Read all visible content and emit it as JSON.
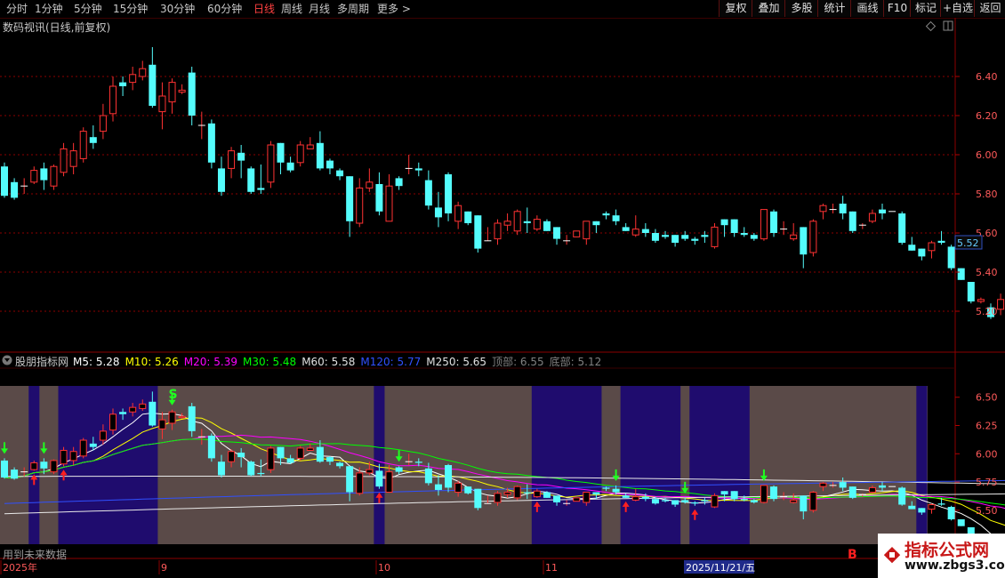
{
  "toolbar": {
    "timeframes": [
      "分时",
      "1分钟",
      "5分钟",
      "15分钟",
      "30分钟",
      "60分钟",
      "日线",
      "周线",
      "月线",
      "多周期",
      "更多 >"
    ],
    "active": "日线",
    "buttons": [
      "复权",
      "叠加",
      "多股",
      "统计",
      "画线",
      "F10",
      "标记",
      "+自选",
      "返回"
    ]
  },
  "main_panel": {
    "title": "数码视讯(日线,前复权)",
    "y_ticks": [
      "6.40",
      "6.20",
      "6.00",
      "5.80",
      "5.60",
      "5.40",
      "5.20"
    ],
    "current_price": "5.52",
    "icons": [
      "diamond-icon",
      "window-icon"
    ]
  },
  "indicator_panel": {
    "title": "股朋指标网",
    "legend": [
      {
        "label": "M5: 5.28",
        "color": "#ffffff"
      },
      {
        "label": "M10: 5.26",
        "color": "#ffff00"
      },
      {
        "label": "M20: 5.39",
        "color": "#ff00ff"
      },
      {
        "label": "M30: 5.48",
        "color": "#00ff00"
      },
      {
        "label": "M60: 5.58",
        "color": "#e0e0e0"
      },
      {
        "label": "M120: 5.77",
        "color": "#3050ff"
      },
      {
        "label": "M250: 5.65",
        "color": "#e0e0e0"
      },
      {
        "label": "顶部: 6.55",
        "color": "#808080"
      },
      {
        "label": "底部: 5.12",
        "color": "#808080"
      }
    ],
    "y_ticks": [
      "6.50",
      "6.25",
      "6.00",
      "5.75",
      "5.50",
      "5.25"
    ],
    "marker_s": "S",
    "marker_b": "B",
    "footnote": "用到未来数据"
  },
  "x_axis": {
    "labels": [
      "2025年",
      "9",
      "10",
      "11"
    ],
    "highlight": "2025/11/21/五"
  },
  "watermark": {
    "line1": "指标公式网",
    "line2": "www.zbgs3.com"
  },
  "colors": {
    "up": "#ff3232",
    "down": "#54fcfc",
    "grid": "#8b0000",
    "panel_gray": "#5a4a48",
    "panel_blue": "#1f0c6e"
  },
  "chart_data": {
    "type": "candlestick",
    "ylim_main": [
      5.1,
      6.6
    ],
    "ylim_indicator": [
      5.2,
      6.6
    ],
    "candles": [
      [
        5.94,
        5.79,
        5.96,
        5.78
      ],
      [
        5.86,
        5.78,
        5.88,
        5.77
      ],
      [
        5.84,
        5.84,
        5.88,
        5.8
      ],
      [
        5.86,
        5.92,
        5.94,
        5.85
      ],
      [
        5.93,
        5.87,
        5.96,
        5.82
      ],
      [
        5.84,
        5.94,
        5.95,
        5.82
      ],
      [
        5.91,
        6.03,
        6.06,
        5.89
      ],
      [
        5.94,
        6.02,
        6.06,
        5.9
      ],
      [
        5.98,
        6.12,
        6.14,
        5.96
      ],
      [
        6.09,
        6.06,
        6.15,
        6.03
      ],
      [
        6.12,
        6.2,
        6.26,
        6.08
      ],
      [
        6.21,
        6.35,
        6.4,
        6.17
      ],
      [
        6.37,
        6.35,
        6.4,
        6.3
      ],
      [
        6.37,
        6.41,
        6.45,
        6.33
      ],
      [
        6.4,
        6.44,
        6.48,
        6.38
      ],
      [
        6.46,
        6.25,
        6.55,
        6.24
      ],
      [
        6.22,
        6.3,
        6.37,
        6.13
      ],
      [
        6.27,
        6.37,
        6.39,
        6.21
      ],
      [
        6.32,
        6.33,
        6.36,
        6.31
      ],
      [
        6.42,
        6.2,
        6.45,
        6.15
      ],
      [
        6.15,
        6.15,
        6.22,
        6.08
      ],
      [
        6.16,
        5.96,
        6.18,
        5.93
      ],
      [
        5.93,
        5.81,
        5.99,
        5.79
      ],
      [
        5.93,
        6.02,
        6.04,
        5.88
      ],
      [
        6.01,
        5.97,
        6.05,
        5.88
      ],
      [
        5.93,
        5.81,
        5.94,
        5.8
      ],
      [
        5.83,
        5.82,
        5.95,
        5.8
      ],
      [
        5.86,
        6.05,
        6.07,
        5.83
      ],
      [
        6.06,
        5.96,
        6.06,
        5.9
      ],
      [
        5.96,
        5.92,
        5.99,
        5.91
      ],
      [
        5.96,
        6.05,
        6.07,
        5.94
      ],
      [
        6.03,
        6.05,
        6.09,
        6.03
      ],
      [
        6.06,
        5.93,
        6.12,
        5.92
      ],
      [
        5.97,
        5.93,
        5.98,
        5.9
      ],
      [
        5.92,
        5.89,
        5.93,
        5.87
      ],
      [
        5.89,
        5.66,
        5.89,
        5.58
      ],
      [
        5.65,
        5.83,
        5.88,
        5.63
      ],
      [
        5.83,
        5.86,
        5.93,
        5.81
      ],
      [
        5.85,
        5.71,
        5.91,
        5.69
      ],
      [
        5.66,
        5.84,
        5.9,
        5.66
      ],
      [
        5.88,
        5.84,
        5.89,
        5.82
      ],
      [
        5.93,
        5.93,
        6.0,
        5.9
      ],
      [
        5.93,
        5.92,
        5.96,
        5.89
      ],
      [
        5.87,
        5.74,
        5.92,
        5.72
      ],
      [
        5.73,
        5.68,
        5.81,
        5.63
      ],
      [
        5.9,
        5.7,
        5.91,
        5.66
      ],
      [
        5.66,
        5.74,
        5.76,
        5.62
      ],
      [
        5.71,
        5.65,
        5.71,
        5.64
      ],
      [
        5.69,
        5.52,
        5.69,
        5.5
      ],
      [
        5.56,
        5.56,
        5.63,
        5.56
      ],
      [
        5.57,
        5.65,
        5.67,
        5.54
      ],
      [
        5.64,
        5.66,
        5.7,
        5.61
      ],
      [
        5.61,
        5.71,
        5.72,
        5.59
      ],
      [
        5.66,
        5.65,
        5.73,
        5.6
      ],
      [
        5.62,
        5.67,
        5.69,
        5.61
      ],
      [
        5.66,
        5.61,
        5.67,
        5.61
      ],
      [
        5.63,
        5.57,
        5.63,
        5.54
      ],
      [
        5.56,
        5.56,
        5.59,
        5.54
      ],
      [
        5.58,
        5.61,
        5.61,
        5.58
      ],
      [
        5.57,
        5.66,
        5.66,
        5.54
      ],
      [
        5.66,
        5.64,
        5.66,
        5.6
      ],
      [
        5.7,
        5.69,
        5.71,
        5.67
      ],
      [
        5.69,
        5.66,
        5.72,
        5.64
      ],
      [
        5.63,
        5.61,
        5.65,
        5.61
      ],
      [
        5.59,
        5.62,
        5.69,
        5.58
      ],
      [
        5.62,
        5.6,
        5.65,
        5.58
      ],
      [
        5.6,
        5.56,
        5.62,
        5.55
      ],
      [
        5.59,
        5.58,
        5.61,
        5.57
      ],
      [
        5.59,
        5.55,
        5.59,
        5.53
      ],
      [
        5.59,
        5.57,
        5.61,
        5.56
      ],
      [
        5.57,
        5.56,
        5.58,
        5.54
      ],
      [
        5.59,
        5.58,
        5.61,
        5.55
      ],
      [
        5.53,
        5.63,
        5.65,
        5.52
      ],
      [
        5.67,
        5.64,
        5.67,
        5.58
      ],
      [
        5.67,
        5.6,
        5.67,
        5.58
      ],
      [
        5.6,
        5.59,
        5.63,
        5.58
      ],
      [
        5.59,
        5.57,
        5.6,
        5.56
      ],
      [
        5.57,
        5.72,
        5.72,
        5.56
      ],
      [
        5.71,
        5.6,
        5.72,
        5.58
      ],
      [
        5.62,
        5.62,
        5.66,
        5.59
      ],
      [
        5.57,
        5.59,
        5.65,
        5.56
      ],
      [
        5.63,
        5.49,
        5.63,
        5.42
      ],
      [
        5.5,
        5.66,
        5.67,
        5.48
      ],
      [
        5.71,
        5.74,
        5.75,
        5.67
      ],
      [
        5.72,
        5.72,
        5.75,
        5.7
      ],
      [
        5.75,
        5.7,
        5.79,
        5.67
      ],
      [
        5.71,
        5.61,
        5.71,
        5.6
      ],
      [
        5.64,
        5.64,
        5.65,
        5.62
      ],
      [
        5.66,
        5.7,
        5.72,
        5.65
      ],
      [
        5.72,
        5.7,
        5.75,
        5.67
      ],
      [
        5.71,
        5.71,
        5.71,
        5.71
      ],
      [
        5.7,
        5.55,
        5.71,
        5.54
      ],
      [
        5.54,
        5.51,
        5.58,
        5.51
      ],
      [
        5.52,
        5.48,
        5.52,
        5.46
      ],
      [
        5.51,
        5.55,
        5.56,
        5.47
      ],
      [
        5.56,
        5.55,
        5.61,
        5.54
      ],
      [
        5.53,
        5.42,
        5.54,
        5.41
      ],
      [
        5.42,
        5.36,
        5.42,
        5.36
      ],
      [
        5.35,
        5.25,
        5.35,
        5.24
      ],
      [
        5.25,
        5.26,
        5.27,
        5.24
      ],
      [
        5.22,
        5.17,
        5.24,
        5.16
      ],
      [
        5.21,
        5.26,
        5.29,
        5.18
      ],
      [
        5.26,
        5.21,
        5.28,
        5.19
      ],
      [
        5.19,
        5.21,
        5.21,
        5.12
      ],
      [
        5.19,
        5.23,
        5.28,
        5.18
      ],
      [
        5.27,
        5.32,
        5.32,
        5.26
      ],
      [
        5.31,
        5.3,
        5.33,
        5.28
      ],
      [
        5.3,
        5.22,
        5.3,
        5.2
      ],
      [
        5.22,
        5.28,
        5.28,
        5.19
      ],
      [
        5.27,
        5.28,
        5.31,
        5.27
      ]
    ],
    "blue_zones": [
      [
        3,
        3
      ],
      [
        6,
        15
      ],
      [
        38,
        38
      ],
      [
        54,
        60
      ],
      [
        63,
        68
      ],
      [
        70,
        75
      ],
      [
        93,
        93
      ]
    ],
    "buy_arrows": [
      3,
      6,
      38,
      54,
      63,
      70
    ],
    "sell_arrows": [
      0,
      4,
      17,
      40,
      62,
      69,
      77
    ]
  }
}
